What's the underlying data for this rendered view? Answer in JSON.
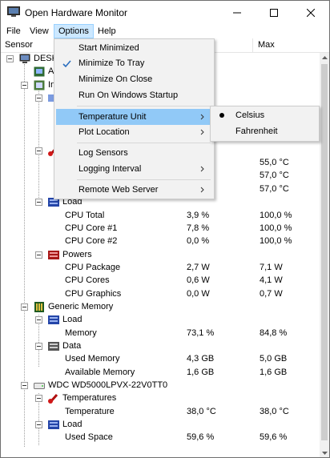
{
  "window": {
    "title": "Open Hardware Monitor"
  },
  "menubar": {
    "items": [
      "File",
      "View",
      "Options",
      "Help"
    ],
    "active": "Options"
  },
  "columns": {
    "sensor": "Sensor",
    "value": "",
    "max": "Max"
  },
  "tree": {
    "root": "DESKTOP",
    "cpu_partial": "A",
    "cpu_sub_partial": "In",
    "temp_values": [
      {
        "max": "55,0 °C"
      },
      {
        "max": "57,0 °C"
      },
      {
        "max": "57,0 °C"
      }
    ],
    "load": {
      "label": "Load",
      "rows": [
        {
          "name": "CPU Total",
          "value": "3,9 %",
          "max": "100,0 %"
        },
        {
          "name": "CPU Core #1",
          "value": "7,8 %",
          "max": "100,0 %"
        },
        {
          "name": "CPU Core #2",
          "value": "0,0 %",
          "max": "100,0 %"
        }
      ]
    },
    "powers": {
      "label": "Powers",
      "rows": [
        {
          "name": "CPU Package",
          "value": "2,7 W",
          "max": "7,1 W"
        },
        {
          "name": "CPU Cores",
          "value": "0,6 W",
          "max": "4,1 W"
        },
        {
          "name": "CPU Graphics",
          "value": "0,0 W",
          "max": "0,7 W"
        }
      ]
    },
    "memory": {
      "label": "Generic Memory",
      "load_label": "Load",
      "load_rows": [
        {
          "name": "Memory",
          "value": "73,1 %",
          "max": "84,8 %"
        }
      ],
      "data_label": "Data",
      "data_rows": [
        {
          "name": "Used Memory",
          "value": "4,3 GB",
          "max": "5,0 GB"
        },
        {
          "name": "Available Memory",
          "value": "1,6 GB",
          "max": "1,6 GB"
        }
      ]
    },
    "disk": {
      "label": "WDC WD5000LPVX-22V0TT0",
      "temp_label": "Temperatures",
      "temp_rows": [
        {
          "name": "Temperature",
          "value": "38,0 °C",
          "max": "38,0 °C"
        }
      ],
      "load_label": "Load",
      "load_rows": [
        {
          "name": "Used Space",
          "value": "59,6 %",
          "max": "59,6 %"
        }
      ]
    }
  },
  "options_menu": {
    "items": [
      {
        "label": "Start Minimized",
        "checked": false
      },
      {
        "label": "Minimize To Tray",
        "checked": true
      },
      {
        "label": "Minimize On Close",
        "checked": false
      },
      {
        "label": "Run On Windows Startup",
        "checked": false
      },
      {
        "label": "Temperature Unit",
        "submenu": true
      },
      {
        "label": "Plot Location",
        "submenu": true
      },
      {
        "label": "Log Sensors",
        "checked": false
      },
      {
        "label": "Logging Interval",
        "submenu": true
      },
      {
        "label": "Remote Web Server",
        "submenu": true
      }
    ]
  },
  "temperature_submenu": {
    "items": [
      {
        "label": "Celsius",
        "selected": true
      },
      {
        "label": "Fahrenheit",
        "selected": false
      }
    ]
  },
  "colors": {
    "menu_highlight": "#91c9f7",
    "menu_active": "#cce8ff",
    "menu_bg": "#f2f2f2"
  }
}
